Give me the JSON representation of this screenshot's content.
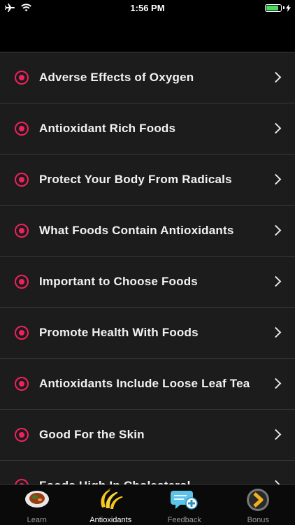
{
  "status_bar": {
    "time": "1:56 PM",
    "battery_level": 0.85,
    "icons": [
      "airplane-icon",
      "wifi-icon",
      "battery-icon",
      "charging-bolt-icon"
    ],
    "battery_color": "#4cd964"
  },
  "list": {
    "accent_color": "#f0215c",
    "items": [
      {
        "label": "Adverse Effects of Oxygen"
      },
      {
        "label": "Antioxidant Rich Foods"
      },
      {
        "label": "Protect Your Body From Radicals"
      },
      {
        "label": "What Foods Contain Antioxidants"
      },
      {
        "label": "Important to Choose Foods"
      },
      {
        "label": "Promote Health With Foods"
      },
      {
        "label": "Antioxidants Include Loose Leaf Tea"
      },
      {
        "label": "Good For the Skin"
      },
      {
        "label": "Foods High In Cholesterol"
      }
    ]
  },
  "tab_bar": {
    "tabs": [
      {
        "label": "Learn",
        "icon": "food-plate-icon",
        "active": false
      },
      {
        "label": "Antioxidants",
        "icon": "banana-icon",
        "active": true
      },
      {
        "label": "Feedback",
        "icon": "chat-bubble-plus-icon",
        "active": false
      },
      {
        "label": "Bonus",
        "icon": "forward-chevron-circle-icon",
        "active": false
      }
    ]
  }
}
